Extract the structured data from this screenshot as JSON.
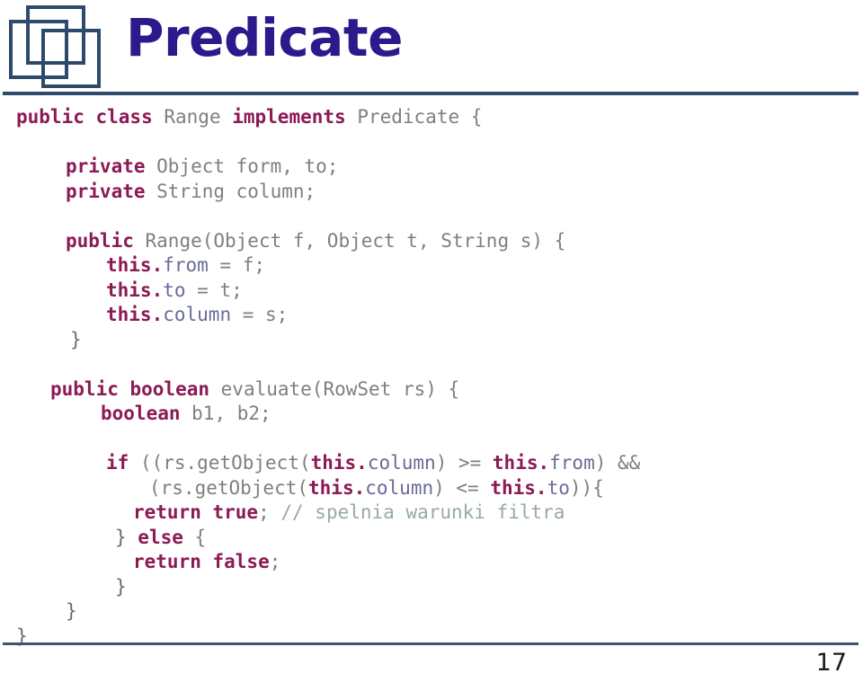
{
  "slide": {
    "title": "Predicate",
    "title_color": "#2a1a8c",
    "logo_name": "three-overlapping-squares-logo",
    "logo_color": "#2e4a6b",
    "rule_color": "#2e4a6b",
    "page_number": "17"
  },
  "theme": {
    "keyword_color": "#8b1a55",
    "plain_color": "#7f7f7f",
    "field_color": "#6a6a9a",
    "comment_color": "#97ab9d",
    "brace_color": "#6b6b6b",
    "background": "#ffffff"
  },
  "code": {
    "language": "java",
    "full_text": "public class Range implements Predicate {\n\n    private Object form, to;\n    private String column;\n\n    public Range(Object f, Object t, String s) {\n        this.from = f;\n        this.to = t;\n        this.column = s;\n    }\n\n    public boolean evaluate(RowSet rs) {\n        boolean b1, b2;\n\n        if ((rs.getObject(this.column) >= this.from) &&\n            (rs.getObject(this.column) <= this.to)){\n          return true; // spelnia warunki filtra\n        } else {\n          return false;\n        }\n    }\n}",
    "lines": [
      {
        "indent": 0,
        "tokens": [
          {
            "t": "public class ",
            "c": "kw"
          },
          {
            "t": "Range ",
            "c": "plain"
          },
          {
            "t": "implements ",
            "c": "kw"
          },
          {
            "t": "Predicate {",
            "c": "plain"
          }
        ]
      },
      {
        "indent": 0,
        "tokens": []
      },
      {
        "indent": 55,
        "tokens": [
          {
            "t": "private ",
            "c": "kw"
          },
          {
            "t": "Object form, to;",
            "c": "plain"
          }
        ]
      },
      {
        "indent": 55,
        "tokens": [
          {
            "t": "private ",
            "c": "kw"
          },
          {
            "t": "String column;",
            "c": "plain"
          }
        ]
      },
      {
        "indent": 0,
        "tokens": []
      },
      {
        "indent": 55,
        "tokens": [
          {
            "t": "public ",
            "c": "kw"
          },
          {
            "t": "Range(Object f, Object t, String s) {",
            "c": "plain"
          }
        ]
      },
      {
        "indent": 100,
        "tokens": [
          {
            "t": "this",
            "c": "kw"
          },
          {
            "t": ".",
            "c": "kw"
          },
          {
            "t": "from",
            "c": "field"
          },
          {
            "t": " = f;",
            "c": "plain"
          }
        ]
      },
      {
        "indent": 100,
        "tokens": [
          {
            "t": "this",
            "c": "kw"
          },
          {
            "t": ".",
            "c": "kw"
          },
          {
            "t": "to",
            "c": "field"
          },
          {
            "t": " = t;",
            "c": "plain"
          }
        ]
      },
      {
        "indent": 100,
        "tokens": [
          {
            "t": "this",
            "c": "kw"
          },
          {
            "t": ".",
            "c": "kw"
          },
          {
            "t": "column",
            "c": "field"
          },
          {
            "t": " = s;",
            "c": "plain"
          }
        ]
      },
      {
        "indent": 60,
        "tokens": [
          {
            "t": "}",
            "c": "brace"
          }
        ]
      },
      {
        "indent": 0,
        "tokens": []
      },
      {
        "indent": 38,
        "tokens": [
          {
            "t": "public boolean ",
            "c": "kw"
          },
          {
            "t": "evaluate(RowSet rs) {",
            "c": "plain"
          }
        ]
      },
      {
        "indent": 94,
        "tokens": [
          {
            "t": "boolean ",
            "c": "kw"
          },
          {
            "t": "b1, b2;",
            "c": "plain"
          }
        ]
      },
      {
        "indent": 0,
        "tokens": []
      },
      {
        "indent": 100,
        "tokens": [
          {
            "t": "if ",
            "c": "kw"
          },
          {
            "t": "((rs.getObject(",
            "c": "plain"
          },
          {
            "t": "this",
            "c": "kw"
          },
          {
            "t": ".",
            "c": "kw"
          },
          {
            "t": "column",
            "c": "field"
          },
          {
            "t": ") >= ",
            "c": "plain"
          },
          {
            "t": "this",
            "c": "kw"
          },
          {
            "t": ".",
            "c": "kw"
          },
          {
            "t": "from",
            "c": "field"
          },
          {
            "t": ") &&",
            "c": "plain"
          }
        ]
      },
      {
        "indent": 148,
        "tokens": [
          {
            "t": "(rs.getObject(",
            "c": "plain"
          },
          {
            "t": "this",
            "c": "kw"
          },
          {
            "t": ".",
            "c": "kw"
          },
          {
            "t": "column",
            "c": "field"
          },
          {
            "t": ") <= ",
            "c": "plain"
          },
          {
            "t": "this",
            "c": "kw"
          },
          {
            "t": ".",
            "c": "kw"
          },
          {
            "t": "to",
            "c": "field"
          },
          {
            "t": ")){",
            "c": "plain"
          }
        ]
      },
      {
        "indent": 130,
        "tokens": [
          {
            "t": "return true",
            "c": "kw"
          },
          {
            "t": "; ",
            "c": "plain"
          },
          {
            "t": "// spelnia warunki filtra",
            "c": "comment"
          }
        ]
      },
      {
        "indent": 110,
        "tokens": [
          {
            "t": "} ",
            "c": "brace"
          },
          {
            "t": "else ",
            "c": "kw"
          },
          {
            "t": "{",
            "c": "plain"
          }
        ]
      },
      {
        "indent": 130,
        "tokens": [
          {
            "t": "return false",
            "c": "kw"
          },
          {
            "t": ";",
            "c": "plain"
          }
        ]
      },
      {
        "indent": 110,
        "tokens": [
          {
            "t": "}",
            "c": "brace"
          }
        ]
      },
      {
        "indent": 55,
        "tokens": [
          {
            "t": "}",
            "c": "brace"
          }
        ]
      },
      {
        "indent": 0,
        "tokens": [
          {
            "t": "}",
            "c": "brace"
          }
        ]
      }
    ]
  }
}
